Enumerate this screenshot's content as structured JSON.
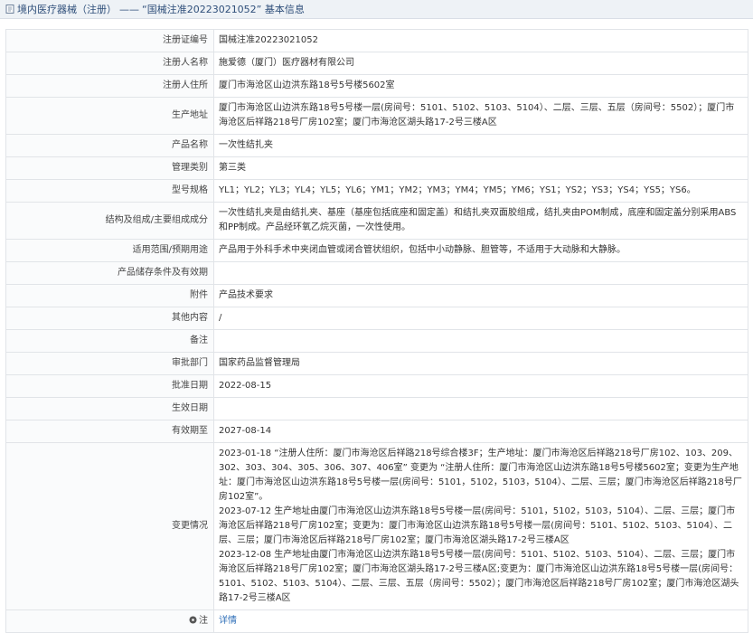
{
  "header": {
    "breadcrumb_link": "境内医疗器械（注册）",
    "separator": "——",
    "title": "“国械注准20223021052” 基本信息"
  },
  "rows": [
    {
      "label": "注册证编号",
      "value": "国械注准20223021052"
    },
    {
      "label": "注册人名称",
      "value": "施爱德（厦门）医疗器材有限公司"
    },
    {
      "label": "注册人住所",
      "value": "厦门市海沧区山边洪东路18号5号楼5602室"
    },
    {
      "label": "生产地址",
      "value": "厦门市海沧区山边洪东路18号5号楼一层(房间号：5101、5102、5103、5104）、二层、三层、五层（房间号：5502）；厦门市海沧区后祥路218号厂房102室；厦门市海沧区湖头路17-2号三楼A区"
    },
    {
      "label": "产品名称",
      "value": "一次性结扎夹"
    },
    {
      "label": "管理类别",
      "value": "第三类"
    },
    {
      "label": "型号规格",
      "value": "YL1；YL2；YL3；YL4；YL5；YL6；YM1；YM2；YM3；YM4；YM5；YM6；YS1；YS2；YS3；YS4；YS5；YS6。"
    },
    {
      "label": "结构及组成/主要组成成分",
      "value": "一次性结扎夹是由结扎夹、基座（基座包括底座和固定盖）和结扎夹双面胶组成，结扎夹由POM制成，底座和固定盖分别采用ABS和PP制成。产品经环氧乙烷灭菌，一次性使用。"
    },
    {
      "label": "适用范围/预期用途",
      "value": "产品用于外科手术中夹闭血管或闭合管状组织，包括中小动静脉、胆管等，不适用于大动脉和大静脉。"
    },
    {
      "label": "产品储存条件及有效期",
      "value": ""
    },
    {
      "label": "附件",
      "value": "产品技术要求"
    },
    {
      "label": "其他内容",
      "value": "/"
    },
    {
      "label": "备注",
      "value": ""
    },
    {
      "label": "审批部门",
      "value": "国家药品监督管理局"
    },
    {
      "label": "批准日期",
      "value": "2022-08-15"
    },
    {
      "label": "生效日期",
      "value": ""
    },
    {
      "label": "有效期至",
      "value": "2027-08-14"
    }
  ],
  "changes": {
    "label": "变更情况",
    "entries": [
      "2023-01-18 “注册人住所：厦门市海沧区后祥路218号综合楼3F；生产地址：厦门市海沧区后祥路218号厂房102、103、209、302、303、304、305、306、307、406室” 变更为 “注册人住所：厦门市海沧区山边洪东路18号5号楼5602室；变更为生产地址：厦门市海沧区山边洪东路18号5号楼一层(房间号：5101，5102，5103，5104）、二层、三层；厦门市海沧区后祥路218号厂房102室”。",
      "2023-07-12 生产地址由厦门市海沧区山边洪东路18号5号楼一层(房间号：5101，5102，5103，5104）、二层、三层；厦门市海沧区后祥路218号厂房102室；变更为：厦门市海沧区山边洪东路18号5号楼一层(房间号：5101、5102、5103、5104）、二层、三层；厦门市海沧区后祥路218号厂房102室；厦门市海沧区湖头路17-2号三楼A区",
      "2023-12-08 生产地址由厦门市海沧区山边洪东路18号5号楼一层(房间号：5101、5102、5103、5104）、二层、三层；厦门市海沧区后祥路218号厂房102室；厦门市海沧区湖头路17-2号三楼A区;变更为：厦门市海沧区山边洪东路18号5号楼一层(房间号：5101、5102、5103、5104）、二层、三层、五层（房间号：5502）；厦门市海沧区后祥路218号厂房102室；厦门市海沧区湖头路17-2号三楼A区"
    ]
  },
  "footer_row": {
    "label": "注",
    "value": "详情"
  },
  "colors": {
    "header_bg": "#eef2f6",
    "header_text": "#2f4f7a",
    "link": "#2f6fb8",
    "border": "#e1e4e8"
  }
}
